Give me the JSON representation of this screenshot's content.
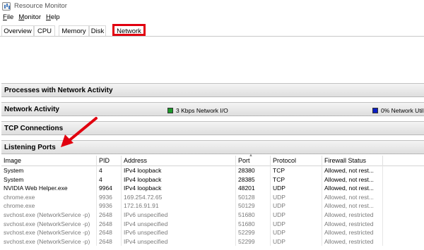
{
  "window": {
    "title": "Resource Monitor"
  },
  "menu": [
    {
      "accel": "F",
      "rest": "ile"
    },
    {
      "accel": "M",
      "rest": "onitor"
    },
    {
      "accel": "H",
      "rest": "elp"
    }
  ],
  "tabs": [
    "Overview",
    "CPU",
    "Memory",
    "Disk",
    "Network"
  ],
  "selected_tab": "Network",
  "sections": {
    "processes": "Processes with Network Activity",
    "network_activity": "Network Activity",
    "network_io": "3 Kbps Network I/O",
    "network_util": "0% Network Util",
    "tcp": "TCP Connections",
    "listening": "Listening Ports"
  },
  "colors": {
    "highlight": "#e1000f",
    "network_io": "#1d9a2a",
    "network_util": "#0c1ec4",
    "annotation_arrow": "#e1000f"
  },
  "listening_ports": {
    "columns": [
      "Image",
      "PID",
      "Address",
      "Port",
      "Protocol",
      "Firewall Status"
    ],
    "rows": [
      {
        "image": "System",
        "pid": "4",
        "address": "IPv4 loopback",
        "port": "28380",
        "protocol": "TCP",
        "firewall": "Allowed, not rest..."
      },
      {
        "image": "System",
        "pid": "4",
        "address": "IPv4 loopback",
        "port": "28385",
        "protocol": "TCP",
        "firewall": "Allowed, not rest..."
      },
      {
        "image": "NVIDIA Web Helper.exe",
        "pid": "9964",
        "address": "IPv4 loopback",
        "port": "48201",
        "protocol": "UDP",
        "firewall": "Allowed, not rest..."
      },
      {
        "image": "chrome.exe",
        "pid": "9936",
        "address": "169.254.72.65",
        "port": "50128",
        "protocol": "UDP",
        "firewall": "Allowed, not rest..."
      },
      {
        "image": "chrome.exe",
        "pid": "9936",
        "address": "172.16.91.91",
        "port": "50129",
        "protocol": "UDP",
        "firewall": "Allowed, not rest..."
      },
      {
        "image": "svchost.exe (NetworkService -p)",
        "pid": "2648",
        "address": "IPv6 unspecified",
        "port": "51680",
        "protocol": "UDP",
        "firewall": "Allowed, restricted"
      },
      {
        "image": "svchost.exe (NetworkService -p)",
        "pid": "2648",
        "address": "IPv4 unspecified",
        "port": "51680",
        "protocol": "UDP",
        "firewall": "Allowed, restricted"
      },
      {
        "image": "svchost.exe (NetworkService -p)",
        "pid": "2648",
        "address": "IPv6 unspecified",
        "port": "52299",
        "protocol": "UDP",
        "firewall": "Allowed, restricted"
      },
      {
        "image": "svchost.exe (NetworkService -p)",
        "pid": "2648",
        "address": "IPv4 unspecified",
        "port": "52299",
        "protocol": "UDP",
        "firewall": "Allowed, restricted"
      }
    ]
  }
}
